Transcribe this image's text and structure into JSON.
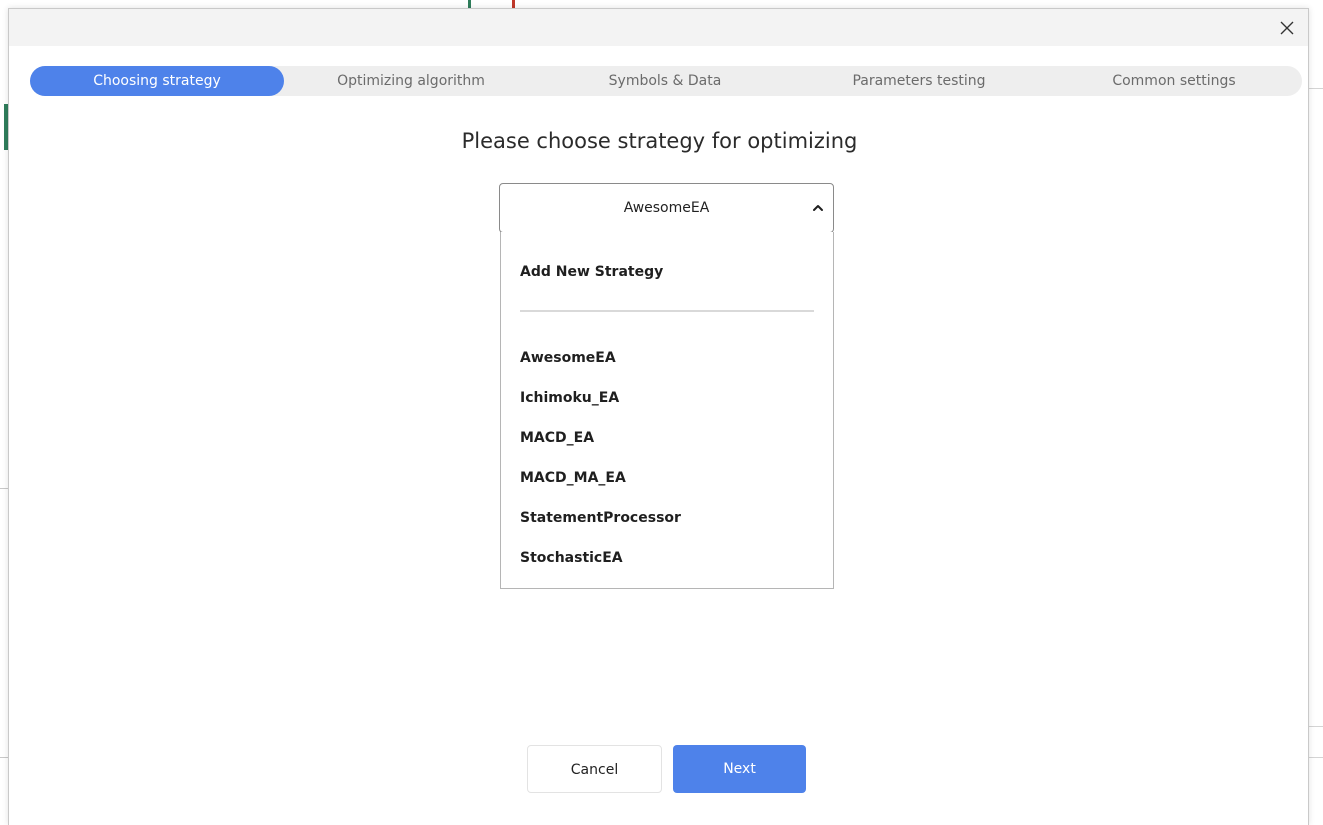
{
  "window": {
    "close_icon": "close-icon"
  },
  "steps": [
    {
      "label": "Choosing strategy",
      "active": true
    },
    {
      "label": "Optimizing algorithm",
      "active": false
    },
    {
      "label": "Symbols & Data",
      "active": false
    },
    {
      "label": "Parameters testing",
      "active": false
    },
    {
      "label": "Common settings",
      "active": false
    }
  ],
  "main": {
    "heading": "Please choose strategy for optimizing"
  },
  "strategy_select": {
    "selected": "AwesomeEA",
    "chevron_icon": "chevron-up-icon",
    "add_new_label": "Add New Strategy",
    "options": [
      "AwesomeEA",
      "Ichimoku_EA",
      "MACD_EA",
      "MACD_MA_EA",
      "StatementProcessor",
      "StochasticEA"
    ]
  },
  "footer": {
    "cancel_label": "Cancel",
    "next_label": "Next"
  },
  "colors": {
    "accent": "#4e82ea",
    "stepper_bg": "#eeeeee",
    "titlebar_bg": "#f3f3f3"
  }
}
